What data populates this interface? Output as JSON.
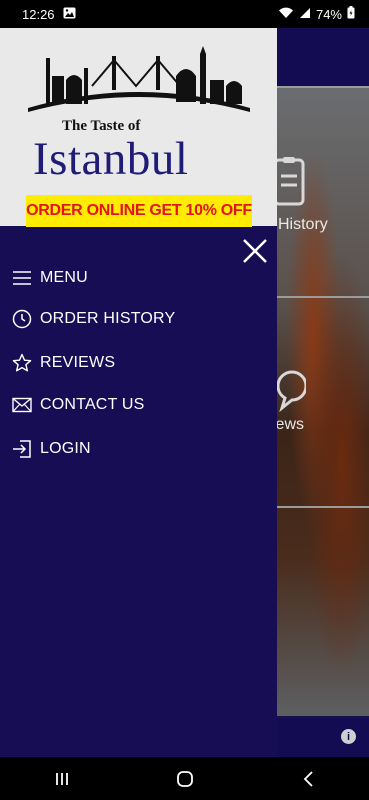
{
  "status_bar": {
    "time": "12:26",
    "battery": "74%"
  },
  "drawer": {
    "logo": {
      "tagline": "The Taste of",
      "brand": "Istanbul",
      "promo": "ORDER ONLINE GET 10% OFF"
    },
    "items": [
      {
        "label": "MENU",
        "icon": "menu-lines-icon"
      },
      {
        "label": "ORDER HISTORY",
        "icon": "clock-icon"
      },
      {
        "label": "REVIEWS",
        "icon": "star-icon"
      },
      {
        "label": "CONTACT US",
        "icon": "envelope-icon"
      },
      {
        "label": "LOGIN",
        "icon": "login-icon"
      }
    ]
  },
  "background": {
    "tile_labels": [
      "History",
      "iews"
    ]
  },
  "colors": {
    "drawer_bg": "#160d55",
    "promo_bg": "#ffec00",
    "promo_text": "#e3141b",
    "brand_text": "#1e1c77"
  }
}
